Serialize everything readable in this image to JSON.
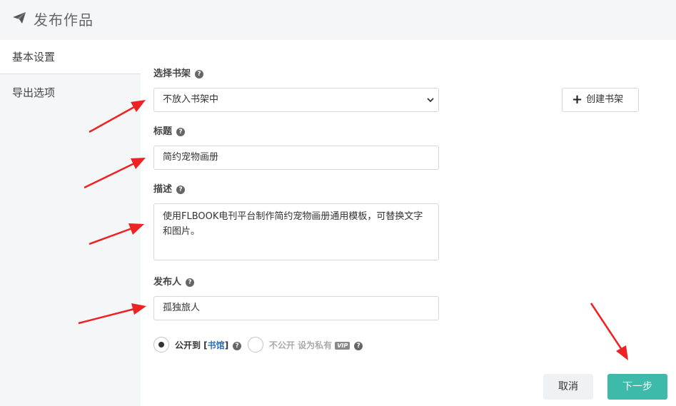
{
  "header": {
    "title": "发布作品"
  },
  "sidebar": {
    "items": [
      {
        "label": "基本设置"
      },
      {
        "label": "导出选项"
      }
    ]
  },
  "form": {
    "bookshelf": {
      "label": "选择书架",
      "value": "不放入书架中",
      "create_label": "创建书架"
    },
    "title": {
      "label": "标题",
      "value": "简约宠物画册"
    },
    "description": {
      "label": "描述",
      "value": "使用FLBOOK电刊平台制作简约宠物画册通用模板，可替换文字和图片。"
    },
    "publisher": {
      "label": "发布人",
      "value": "孤独旅人"
    },
    "visibility": {
      "public_prefix": "公开到 [",
      "public_link": "书馆",
      "public_suffix": "]",
      "private_label": "不公开 设为私有",
      "vip_badge": "VIP",
      "selected": "public"
    }
  },
  "actions": {
    "cancel_label": "取消",
    "next_label": "下一步"
  },
  "colors": {
    "accent": "#3dbaaa",
    "annotation": "#ee2222",
    "link": "#2b6fb6"
  }
}
